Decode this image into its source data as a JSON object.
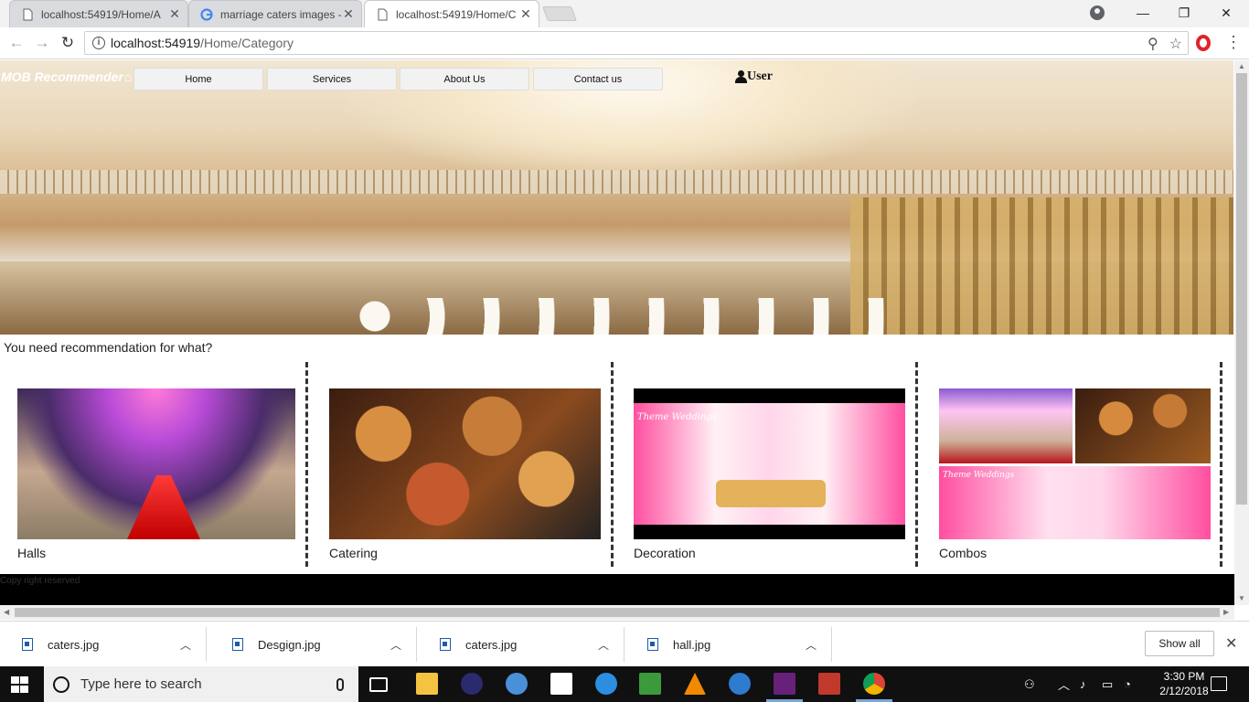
{
  "browser": {
    "tabs": [
      {
        "title": "localhost:54919/Home/A",
        "active": false
      },
      {
        "title": "marriage caters images -",
        "active": false
      },
      {
        "title": "localhost:54919/Home/C",
        "active": true
      }
    ],
    "url_host": "localhost:54919",
    "url_path": "/Home/Category"
  },
  "site": {
    "brand": "MOB Recommender",
    "nav": [
      "Home",
      "Services",
      "About Us",
      "Contact us"
    ],
    "user_label": "User",
    "question": "You need recommendation for what?",
    "categories": [
      {
        "label": "Halls",
        "image": "hall-banquet-image"
      },
      {
        "label": "Catering",
        "image": "catering-dishes-image"
      },
      {
        "label": "Decoration",
        "image": "stage-decoration-image",
        "overlay_text": "Theme Weddings"
      },
      {
        "label": "Combos",
        "image": "combo-collage-image",
        "overlay_text": "Theme Weddings"
      }
    ],
    "footer_text": "Copy right reserved"
  },
  "downloads": {
    "items": [
      "caters.jpg",
      "Desgign.jpg",
      "caters.jpg",
      "hall.jpg"
    ],
    "show_all": "Show all"
  },
  "taskbar": {
    "search_placeholder": "Type here to search",
    "time": "3:30 PM",
    "date": "2/12/2018"
  },
  "colors": {
    "footer": "#000000",
    "nav_button": "#f2f2f2",
    "taskbar": "#101010",
    "link_icon": "#1e5ba8"
  }
}
